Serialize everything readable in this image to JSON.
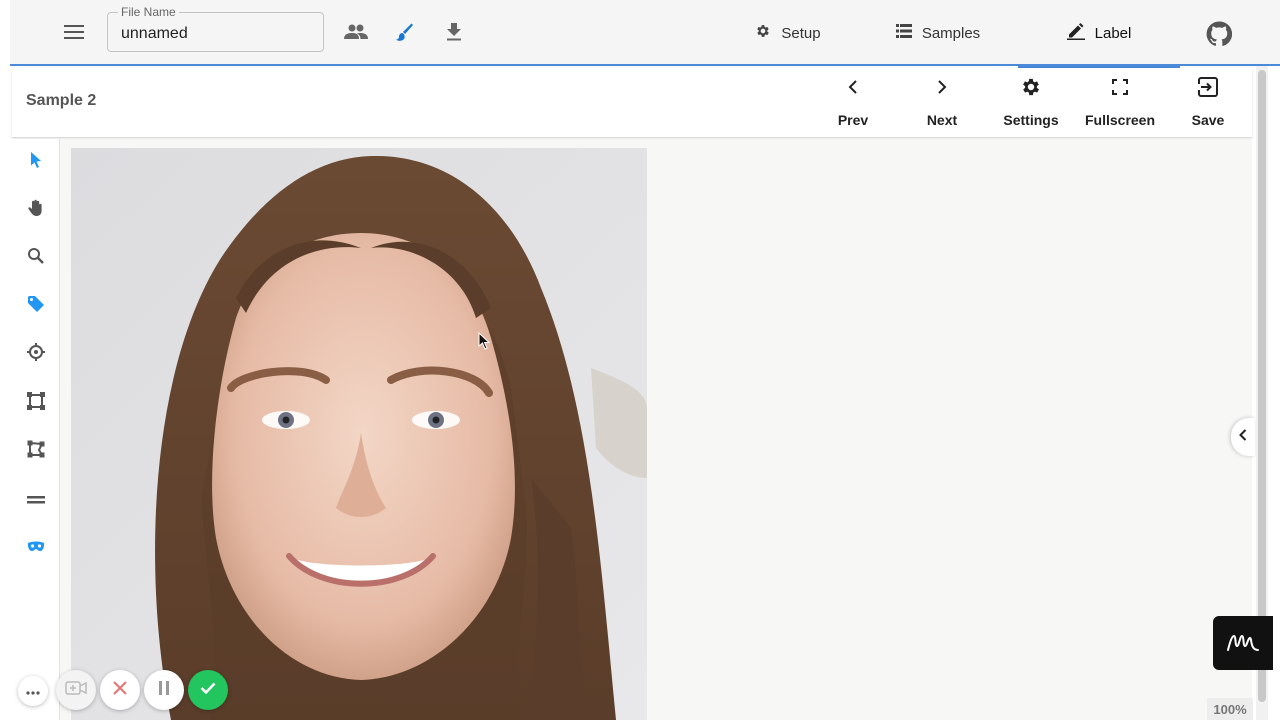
{
  "topbar": {
    "file_name_label": "File Name",
    "file_name_value": "unnamed",
    "tabs": [
      {
        "label": "Setup",
        "icon": "gear-icon"
      },
      {
        "label": "Samples",
        "icon": "list-icon"
      },
      {
        "label": "Label",
        "icon": "pencil-icon",
        "active": true
      }
    ]
  },
  "header": {
    "sample_title": "Sample 2",
    "buttons": {
      "prev": "Prev",
      "next": "Next",
      "settings": "Settings",
      "fullscreen": "Fullscreen",
      "save": "Save"
    }
  },
  "tools": [
    "cursor-arrow-icon",
    "pan-hand-icon",
    "zoom-search-icon",
    "tag-icon",
    "crosshair-point-icon",
    "bounding-box-icon",
    "polygon-icon",
    "line-icon",
    "mask-icon"
  ],
  "canvas": {
    "zoom": "100%"
  },
  "colors": {
    "accent": "#4a8ad8",
    "tool_active": "#2196f3",
    "confirm": "#22c55e",
    "cancel": "#e57373"
  }
}
